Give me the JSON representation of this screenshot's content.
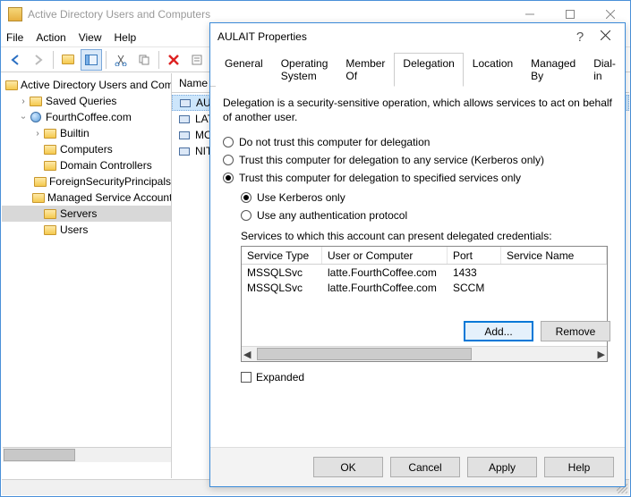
{
  "window": {
    "title": "Active Directory Users and Computers",
    "menus": [
      "File",
      "Action",
      "View",
      "Help"
    ]
  },
  "tree": {
    "root": "Active Directory Users and Computers",
    "saved_queries": "Saved Queries",
    "domain": "FourthCoffee.com",
    "children": [
      "Builtin",
      "Computers",
      "Domain Controllers",
      "ForeignSecurityPrincipals",
      "Managed Service Accounts",
      "Servers",
      "Users"
    ],
    "selected_index": 5
  },
  "list": {
    "header": "Name",
    "items": [
      "AULAIT",
      "LATTE",
      "MOCHA",
      "NITRO"
    ],
    "selected_index": 0
  },
  "dialog": {
    "title": "AULAIT Properties",
    "tabs": [
      "General",
      "Operating System",
      "Member Of",
      "Delegation",
      "Location",
      "Managed By",
      "Dial-in"
    ],
    "active_tab_index": 3,
    "description": "Delegation is a security-sensitive operation, which allows services to act on behalf of another user.",
    "radios_main": [
      "Do not trust this computer for delegation",
      "Trust this computer for delegation to any service (Kerberos only)",
      "Trust this computer for delegation to specified services only"
    ],
    "radios_main_selected": 2,
    "radios_sub": [
      "Use Kerberos only",
      "Use any authentication protocol"
    ],
    "radios_sub_selected": 0,
    "services_label": "Services to which this account can present delegated credentials:",
    "svc_columns": [
      "Service Type",
      "User or Computer",
      "Port",
      "Service Name"
    ],
    "svc_rows": [
      {
        "type": "MSSQLSvc",
        "host": "latte.FourthCoffee.com",
        "port": "1433"
      },
      {
        "type": "MSSQLSvc",
        "host": "latte.FourthCoffee.com",
        "port": "SCCM"
      }
    ],
    "expanded_label": "Expanded",
    "add_label": "Add...",
    "remove_label": "Remove",
    "footer": {
      "ok": "OK",
      "cancel": "Cancel",
      "apply": "Apply",
      "help": "Help"
    }
  }
}
